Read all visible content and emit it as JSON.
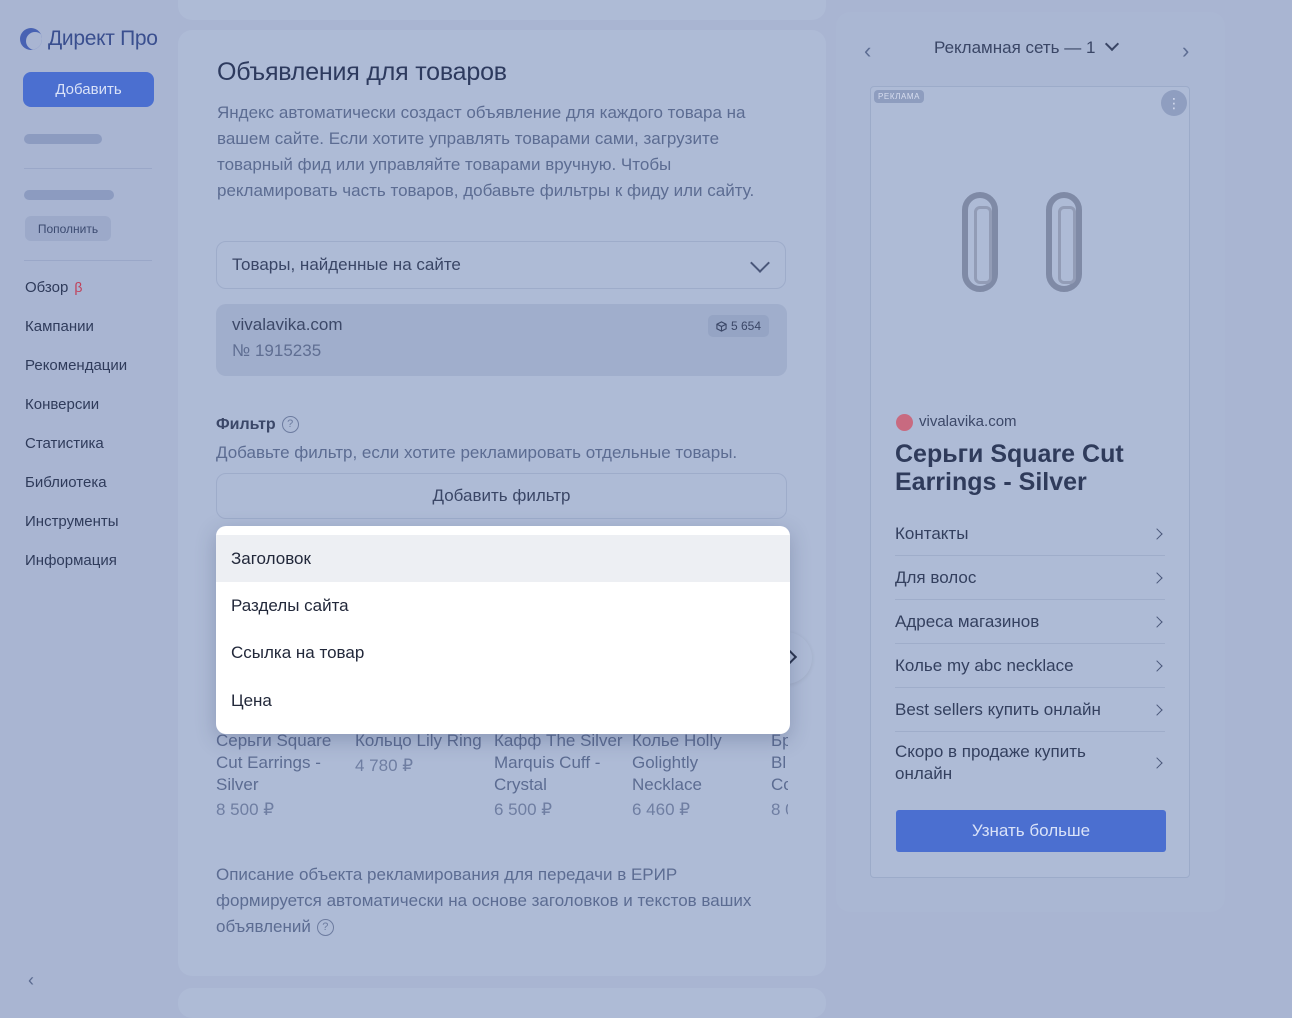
{
  "sidebar": {
    "logo_text": "Директ Про",
    "add_button": "Добавить",
    "topup_button": "Пополнить",
    "nav": [
      {
        "label": "Обзор",
        "badge": "β"
      },
      {
        "label": "Кампании"
      },
      {
        "label": "Рекомендации"
      },
      {
        "label": "Конверсии"
      },
      {
        "label": "Статистика"
      },
      {
        "label": "Библиотека"
      },
      {
        "label": "Инструменты"
      },
      {
        "label": "Информация"
      }
    ],
    "collapse_icon": "‹"
  },
  "main": {
    "title": "Объявления для товаров",
    "description": "Яндекс автоматически создаст объявление для каждого товара на вашем сайте. Если хотите управлять товарами сами, загрузите товарный фид или управляйте товарами вручную. Чтобы рекламировать часть товаров, добавьте фильтры к фиду или сайту.",
    "source_select": "Товары, найденные на сайте",
    "site": {
      "domain": "vivalavika.com",
      "number": "№ 1915235",
      "count": "5 654"
    },
    "filter": {
      "title": "Фильтр",
      "hint": "Добавьте фильтр, если хотите рекламировать отдельные товары.",
      "add_button": "Добавить фильтр"
    },
    "dropdown": [
      "Заголовок",
      "Разделы сайта",
      "Ссылка на товар",
      "Цена"
    ],
    "products": [
      {
        "name": "Серьги Square Cut Earrings - Silver",
        "price": "8 500 ₽"
      },
      {
        "name": "Кольцо Lily Ring",
        "price": "4 780 ₽"
      },
      {
        "name": "Кафф The Silver Marquis Cuff - Crystal",
        "price": "6 500 ₽"
      },
      {
        "name": "Колье Holly Golightly Necklace",
        "price": "6 460 ₽"
      },
      {
        "name": "Бр Bl Cc",
        "price": "8 0"
      }
    ],
    "erir_note": "Описание объекта рекламирования для передачи в ЕРИР формируется автоматически на основе заголовков и текстов ваших объявлений"
  },
  "preview": {
    "title": "Рекламная сеть — 1",
    "ad_tag": "РЕКЛАМА",
    "domain": "vivalavika.com",
    "headline": "Серьги Square Cut Earrings - Silver",
    "links": [
      "Контакты",
      "Для волос",
      "Адреса магазинов",
      "Колье my abc necklace",
      "Best sellers купить онлайн",
      "Скоро в продаже купить онлайн"
    ],
    "cta": "Узнать больше"
  },
  "colors": {
    "accent": "#4b6fd0",
    "overlay_bg": "#a9b5d2",
    "dropdown_bg": "#ffffff"
  }
}
